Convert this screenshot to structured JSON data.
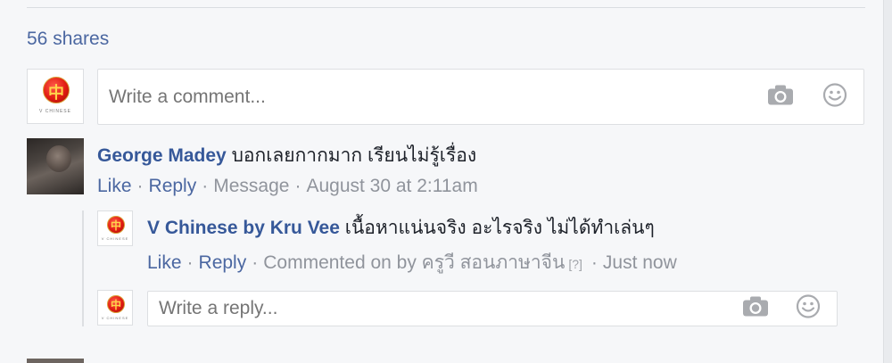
{
  "shares_label": "56 shares",
  "composer": {
    "placeholder": "Write a comment..."
  },
  "comments": [
    {
      "author": "George Madey",
      "text": "บอกเลยกากมาก เรียนไม่รู้เรื่อง",
      "actions": {
        "like": "Like",
        "reply": "Reply",
        "message": "Message",
        "time": "August 30 at 2:11am"
      },
      "replies": [
        {
          "author": "V Chinese by Kru Vee",
          "text": "เนื้อหาแน่นจริง อะไรจริง ไม่ได้ทำเล่นๆ",
          "actions": {
            "like": "Like",
            "reply": "Reply",
            "commented_on": "Commented on by ครูวี สอนภาษาจีน",
            "unknown_glyph": "[?]",
            "time": "Just now"
          }
        }
      ],
      "reply_composer": {
        "placeholder": "Write a reply..."
      }
    }
  ],
  "icons": {
    "camera": "camera-icon",
    "emoji": "emoji-icon"
  },
  "colors": {
    "link": "#365899",
    "meta": "#90949c",
    "background": "#f6f7f9"
  }
}
